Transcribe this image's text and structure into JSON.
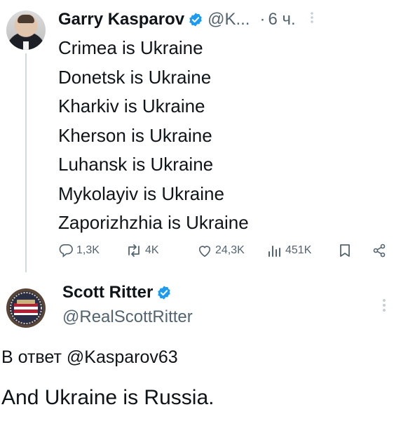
{
  "tweet1": {
    "author_name": "Garry Kasparov",
    "handle": "@K...",
    "separator": "·",
    "time": "6 ч.",
    "lines": [
      "Crimea is Ukraine",
      "Donetsk is Ukraine",
      "Kharkiv is Ukraine",
      "Kherson is Ukraine",
      "Luhansk is Ukraine",
      "Mykolayiv is Ukraine",
      "Zaporizhzhia is Ukraine"
    ],
    "stats": {
      "replies": "1,3K",
      "reposts": "4K",
      "likes": "24,3K",
      "views": "451K"
    }
  },
  "tweet2": {
    "author_name": "Scott Ritter",
    "handle": "@RealScottRitter",
    "reply_to": "В ответ @Kasparov63",
    "text": "And Ukraine is Russia."
  },
  "colors": {
    "text": "#0f1419",
    "secondary": "#536471",
    "verified": "#1d9bf0",
    "thread_line": "#cfd9de"
  },
  "icons": {
    "reply": "reply-icon",
    "repost": "repost-icon",
    "like": "heart-icon",
    "views": "views-icon",
    "bookmark": "bookmark-icon",
    "share": "share-icon",
    "verified": "verified-badge-icon",
    "more": "more-options-icon"
  }
}
